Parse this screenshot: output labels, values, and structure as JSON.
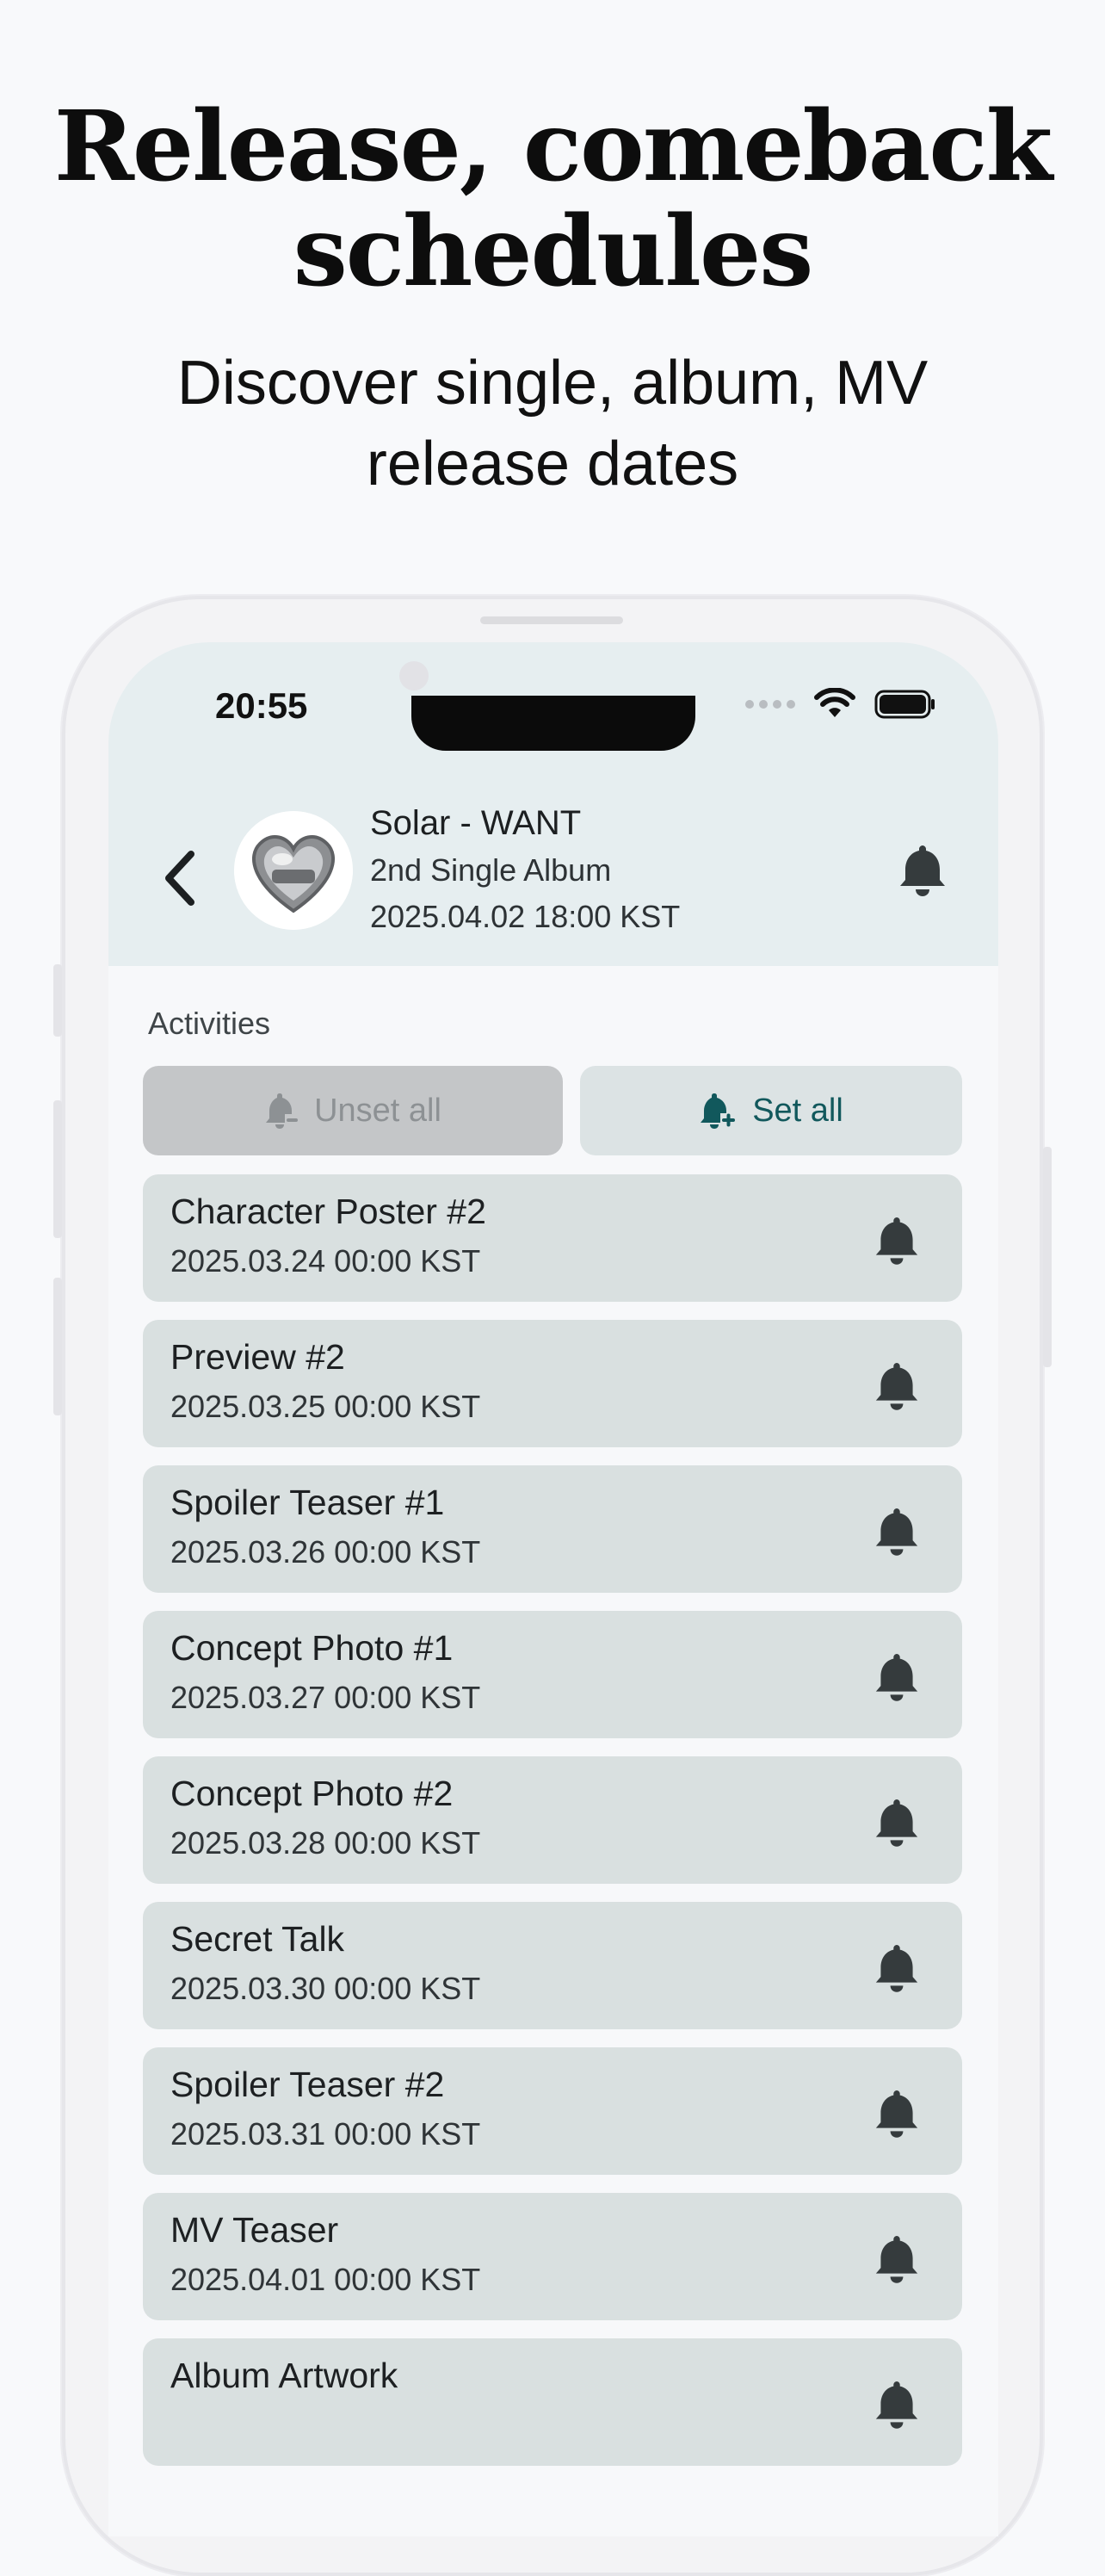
{
  "promo": {
    "headline_line1": "Release, comeback",
    "headline_line2": "schedules",
    "subhead_line1": "Discover single, album, MV",
    "subhead_line2": "release dates"
  },
  "status_bar": {
    "time": "20:55",
    "icons": [
      "signal-icon",
      "wifi-icon",
      "battery-icon"
    ]
  },
  "header": {
    "title": "Solar - WANT",
    "album_type": "2nd Single Album",
    "release_date": "2025.04.02 18:00 KST",
    "back_icon": "chevron-left-icon",
    "bell_icon": "bell-icon"
  },
  "activities": {
    "label": "Activities",
    "unset_all_label": "Unset all",
    "set_all_label": "Set all",
    "items": [
      {
        "name": "Character Poster #2",
        "date": "2025.03.24 00:00 KST"
      },
      {
        "name": "Preview #2",
        "date": "2025.03.25 00:00 KST"
      },
      {
        "name": "Spoiler Teaser #1",
        "date": "2025.03.26 00:00 KST"
      },
      {
        "name": "Concept Photo #1",
        "date": "2025.03.27 00:00 KST"
      },
      {
        "name": "Concept Photo #2",
        "date": "2025.03.28 00:00 KST"
      },
      {
        "name": "Secret Talk",
        "date": "2025.03.30 00:00 KST"
      },
      {
        "name": "Spoiler Teaser #2",
        "date": "2025.03.31 00:00 KST"
      },
      {
        "name": "MV Teaser",
        "date": "2025.04.01 00:00 KST"
      },
      {
        "name": "Album Artwork",
        "date": ""
      }
    ]
  },
  "colors": {
    "accent": "#11585c",
    "header_bg": "#e6eef0",
    "card_bg": "#d9e0e0",
    "bell": "#353b3d"
  }
}
